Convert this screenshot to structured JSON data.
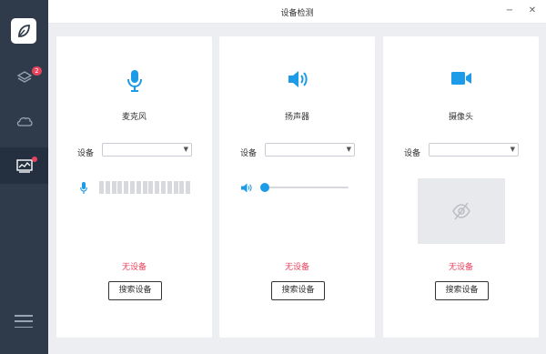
{
  "window": {
    "title": "设备检测",
    "minimize": "−",
    "close": "✕"
  },
  "sidebar": {
    "logo_icon": "leaf-icon",
    "items": [
      {
        "icon": "layers-icon",
        "badge": "2"
      },
      {
        "icon": "cloud-icon"
      },
      {
        "icon": "monitor-chart-icon",
        "active": true,
        "dot": true
      }
    ],
    "menu_icon": "menu-icon"
  },
  "device_label": "设备",
  "no_device_text": "无设备",
  "search_label": "搜索设备",
  "cards": {
    "microphone": {
      "title": "麦克风",
      "icon": "microphone-icon",
      "selected": "",
      "level": 0
    },
    "speaker": {
      "title": "扬声器",
      "icon": "speaker-icon",
      "selected": "",
      "volume": 0
    },
    "camera": {
      "title": "摄像头",
      "icon": "video-camera-icon",
      "selected": "",
      "preview_icon": "no-camera-icon"
    }
  },
  "colors": {
    "accent": "#1e9be8",
    "warning": "#e8435f",
    "sidebar": "#2f3b4a"
  }
}
